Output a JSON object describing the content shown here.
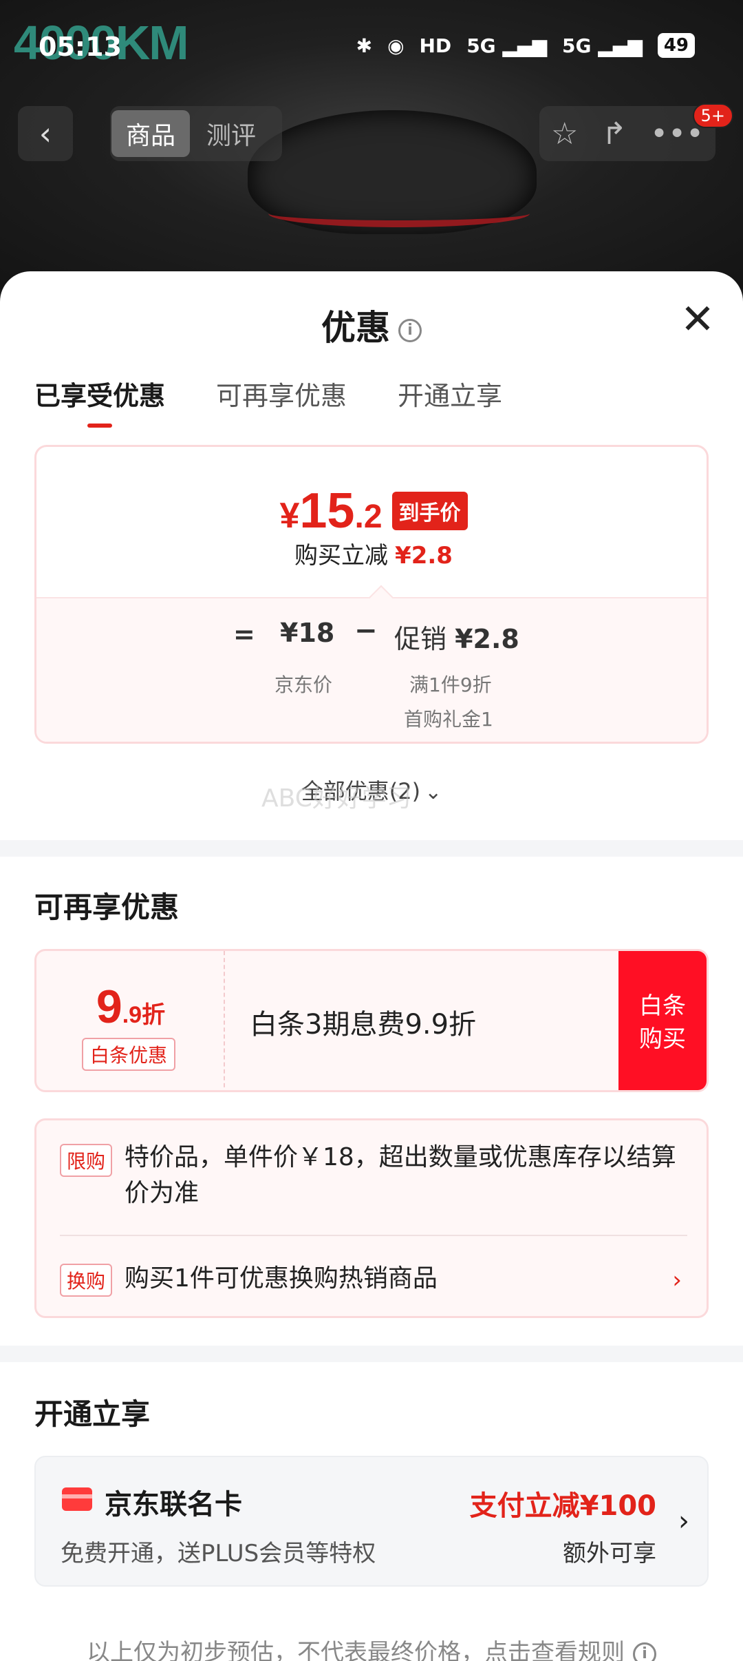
{
  "status_bar": {
    "time": "05:13",
    "bluetooth": "✱",
    "location": "◉",
    "hd": "HD",
    "signal1": "5G ▂▄▆",
    "signal2": "5G ▂▄▆",
    "battery": "49"
  },
  "background": {
    "watermark": "4000KM"
  },
  "nav": {
    "back": "‹",
    "tab_product": "商品",
    "tab_review": "测评",
    "star": "☆",
    "share": "↱",
    "more": "•••",
    "badge": "5+"
  },
  "sheet": {
    "title": "优惠",
    "info": "i",
    "close": "✕",
    "tabs": [
      {
        "label": "已享受优惠",
        "active": true
      },
      {
        "label": "可再享优惠",
        "active": false
      },
      {
        "label": "开通立享",
        "active": false
      }
    ]
  },
  "price_card": {
    "currency": "¥",
    "final_int": "15",
    "final_dec": ".2",
    "final_tag": "到手价",
    "reduce_label": "购买立减",
    "reduce_value": "¥2.8",
    "equals": "=",
    "jd_price": "¥18",
    "jd_label": "京东价",
    "minus": "−",
    "promo_label": "促销",
    "promo_value": "¥2.8",
    "promo_detail1": "满1件9折",
    "promo_detail2": "首购礼金1"
  },
  "all_promos": {
    "label": "全部优惠(2)",
    "chevron": "⌄",
    "overlay": "ABC好好学习"
  },
  "more_promos": {
    "title": "可再享优惠",
    "baitiao": {
      "disc_big": "9",
      "disc_small": ".9折",
      "tag": "白条优惠",
      "text": "白条3期息费9.9折",
      "button": "白条\n购买"
    },
    "limit": {
      "tag": "限购",
      "text": "特价品，单件价￥18，超出数量或优惠库存以结算价为准"
    },
    "exchange": {
      "tag": "换购",
      "text": "购买1件可优惠换购热销商品",
      "chevron": "›"
    }
  },
  "open_section": {
    "title": "开通立享",
    "card": {
      "title": "京东联名卡",
      "subtitle": "免费开通，送PLUS会员等特权",
      "benefit": "支付立减¥100",
      "extra": "额外可享",
      "chevron": "›"
    }
  },
  "footer": {
    "note": "以上仅为初步预估，不代表最终价格，点击查看规则",
    "info": "i"
  }
}
